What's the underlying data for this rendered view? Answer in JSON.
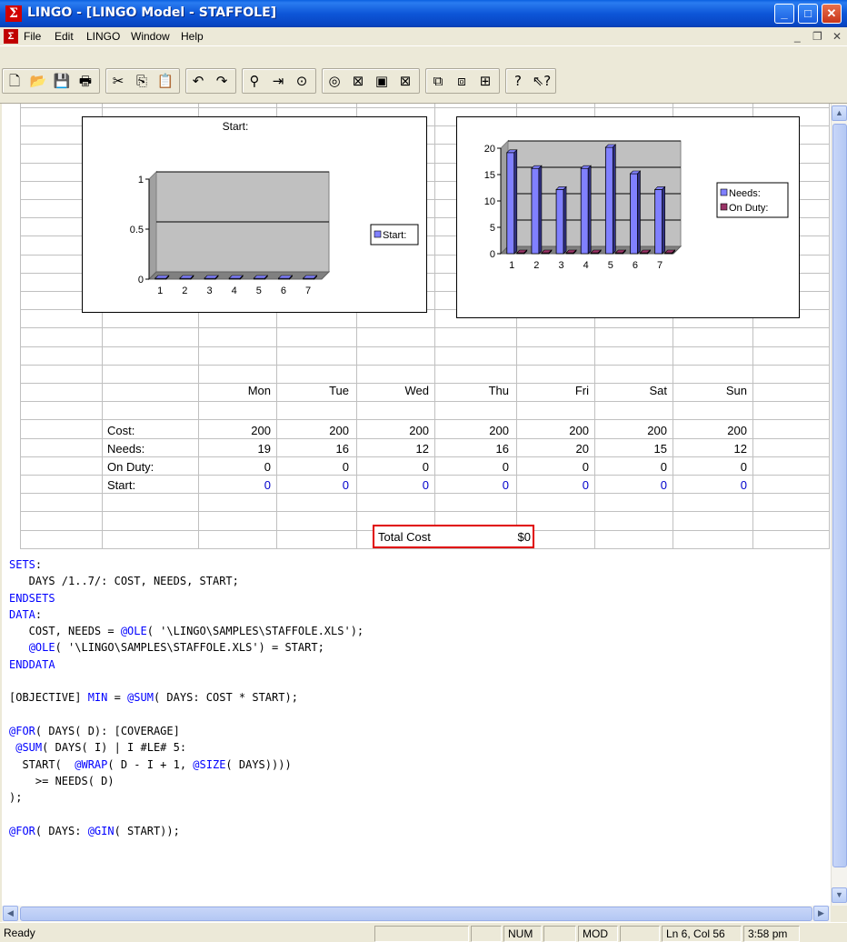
{
  "window": {
    "title": "LINGO - [LINGO Model - STAFFOLE]",
    "controls": {
      "minimize": "_",
      "maximize": "□",
      "close": "✕"
    }
  },
  "menu": {
    "items": [
      "File",
      "Edit",
      "LINGO",
      "Window",
      "Help"
    ],
    "mdi_controls": {
      "minimize": "_",
      "restore": "❐",
      "close": "✕"
    }
  },
  "toolbar": {
    "buttons": [
      {
        "name": "new-icon",
        "glyph": "🗋"
      },
      {
        "name": "open-icon",
        "glyph": "📂"
      },
      {
        "name": "save-icon",
        "glyph": "💾"
      },
      {
        "name": "print-icon",
        "glyph": "🖶"
      },
      {
        "name": "cut-icon",
        "glyph": "✂"
      },
      {
        "name": "copy-icon",
        "glyph": "⎘"
      },
      {
        "name": "paste-icon",
        "glyph": "📋"
      },
      {
        "name": "undo-icon",
        "glyph": "↶"
      },
      {
        "name": "redo-icon",
        "glyph": "↷"
      },
      {
        "name": "find-icon",
        "glyph": "⚲"
      },
      {
        "name": "goto-line-icon",
        "glyph": "⇥"
      },
      {
        "name": "match-paren-icon",
        "glyph": "⊙"
      },
      {
        "name": "solve-icon",
        "glyph": "◎"
      },
      {
        "name": "solution-icon",
        "glyph": "⊠"
      },
      {
        "name": "matrix-picture-icon",
        "glyph": "▣"
      },
      {
        "name": "close-all-icon",
        "glyph": "⊠"
      },
      {
        "name": "tile-icon",
        "glyph": "⧉"
      },
      {
        "name": "send-to-back-icon",
        "glyph": "⧈"
      },
      {
        "name": "cascade-icon",
        "glyph": "⊞"
      },
      {
        "name": "help-icon",
        "glyph": "?"
      },
      {
        "name": "context-help-icon",
        "glyph": "⇖?"
      }
    ]
  },
  "sheet": {
    "days": [
      "Mon",
      "Tue",
      "Wed",
      "Thu",
      "Fri",
      "Sat",
      "Sun"
    ],
    "row_labels": {
      "cost": "Cost:",
      "needs": "Needs:",
      "on_duty": "On Duty:",
      "start": "Start:"
    },
    "cost": [
      "200",
      "200",
      "200",
      "200",
      "200",
      "200",
      "200"
    ],
    "needs": [
      "19",
      "16",
      "12",
      "16",
      "20",
      "15",
      "12"
    ],
    "on_duty": [
      "0",
      "0",
      "0",
      "0",
      "0",
      "0",
      "0"
    ],
    "start": [
      "0",
      "0",
      "0",
      "0",
      "0",
      "0",
      "0"
    ],
    "total_label": "Total Cost",
    "total_value": "$0"
  },
  "chart_data": [
    {
      "type": "bar",
      "title": "Start:",
      "categories": [
        "1",
        "2",
        "3",
        "4",
        "5",
        "6",
        "7"
      ],
      "series": [
        {
          "name": "Start:",
          "values": [
            0,
            0,
            0,
            0,
            0,
            0,
            0
          ]
        }
      ],
      "yticks": [
        "0",
        "0.5",
        "1"
      ],
      "ylim": [
        0,
        1
      ],
      "legend": "right",
      "colors": [
        "#8080ff"
      ]
    },
    {
      "type": "bar",
      "categories": [
        "1",
        "2",
        "3",
        "4",
        "5",
        "6",
        "7"
      ],
      "series": [
        {
          "name": "Needs:",
          "values": [
            19,
            16,
            12,
            16,
            20,
            15,
            12
          ]
        },
        {
          "name": "On Duty:",
          "values": [
            0,
            0,
            0,
            0,
            0,
            0,
            0
          ]
        }
      ],
      "yticks": [
        "0",
        "5",
        "10",
        "15",
        "20"
      ],
      "ylim": [
        0,
        20
      ],
      "legend": "right",
      "colors": [
        "#8080ff",
        "#993366"
      ]
    }
  ],
  "code": [
    [
      {
        "k": true,
        "t": "SETS"
      },
      {
        "t": ":"
      }
    ],
    [
      {
        "t": "   DAYS /1..7/: COST, NEEDS, START;"
      }
    ],
    [
      {
        "k": true,
        "t": "ENDSETS"
      }
    ],
    [
      {
        "k": true,
        "t": "DATA"
      },
      {
        "t": ":"
      }
    ],
    [
      {
        "t": "   COST, NEEDS = "
      },
      {
        "k": true,
        "t": "@OLE"
      },
      {
        "t": "( '\\LINGO\\SAMPLES\\STAFFOLE.XLS');"
      }
    ],
    [
      {
        "t": "   "
      },
      {
        "k": true,
        "t": "@OLE"
      },
      {
        "t": "( '\\LINGO\\SAMPLES\\STAFFOLE.XLS') = START;"
      }
    ],
    [
      {
        "k": true,
        "t": "ENDDATA"
      }
    ],
    [
      {
        "t": ""
      }
    ],
    [
      {
        "t": "[OBJECTIVE] "
      },
      {
        "k": true,
        "t": "MIN"
      },
      {
        "t": " = "
      },
      {
        "k": true,
        "t": "@SUM"
      },
      {
        "t": "( DAYS: COST * START);"
      }
    ],
    [
      {
        "t": ""
      }
    ],
    [
      {
        "k": true,
        "t": "@FOR"
      },
      {
        "t": "( DAYS( D): [COVERAGE]"
      }
    ],
    [
      {
        "t": " "
      },
      {
        "k": true,
        "t": "@SUM"
      },
      {
        "t": "( DAYS( I) | I #LE# 5:"
      }
    ],
    [
      {
        "t": "  START(  "
      },
      {
        "k": true,
        "t": "@WRAP"
      },
      {
        "t": "( D - I + 1, "
      },
      {
        "k": true,
        "t": "@SIZE"
      },
      {
        "t": "( DAYS))))"
      }
    ],
    [
      {
        "t": "    >= NEEDS( D)"
      }
    ],
    [
      {
        "t": ");"
      }
    ],
    [
      {
        "t": ""
      }
    ],
    [
      {
        "k": true,
        "t": "@FOR"
      },
      {
        "t": "( DAYS: "
      },
      {
        "k": true,
        "t": "@GIN"
      },
      {
        "t": "( START));"
      }
    ]
  ],
  "status": {
    "ready": "Ready",
    "num": "NUM",
    "mod": "MOD",
    "position": "Ln 6, Col 56",
    "time": "3:58 pm"
  }
}
